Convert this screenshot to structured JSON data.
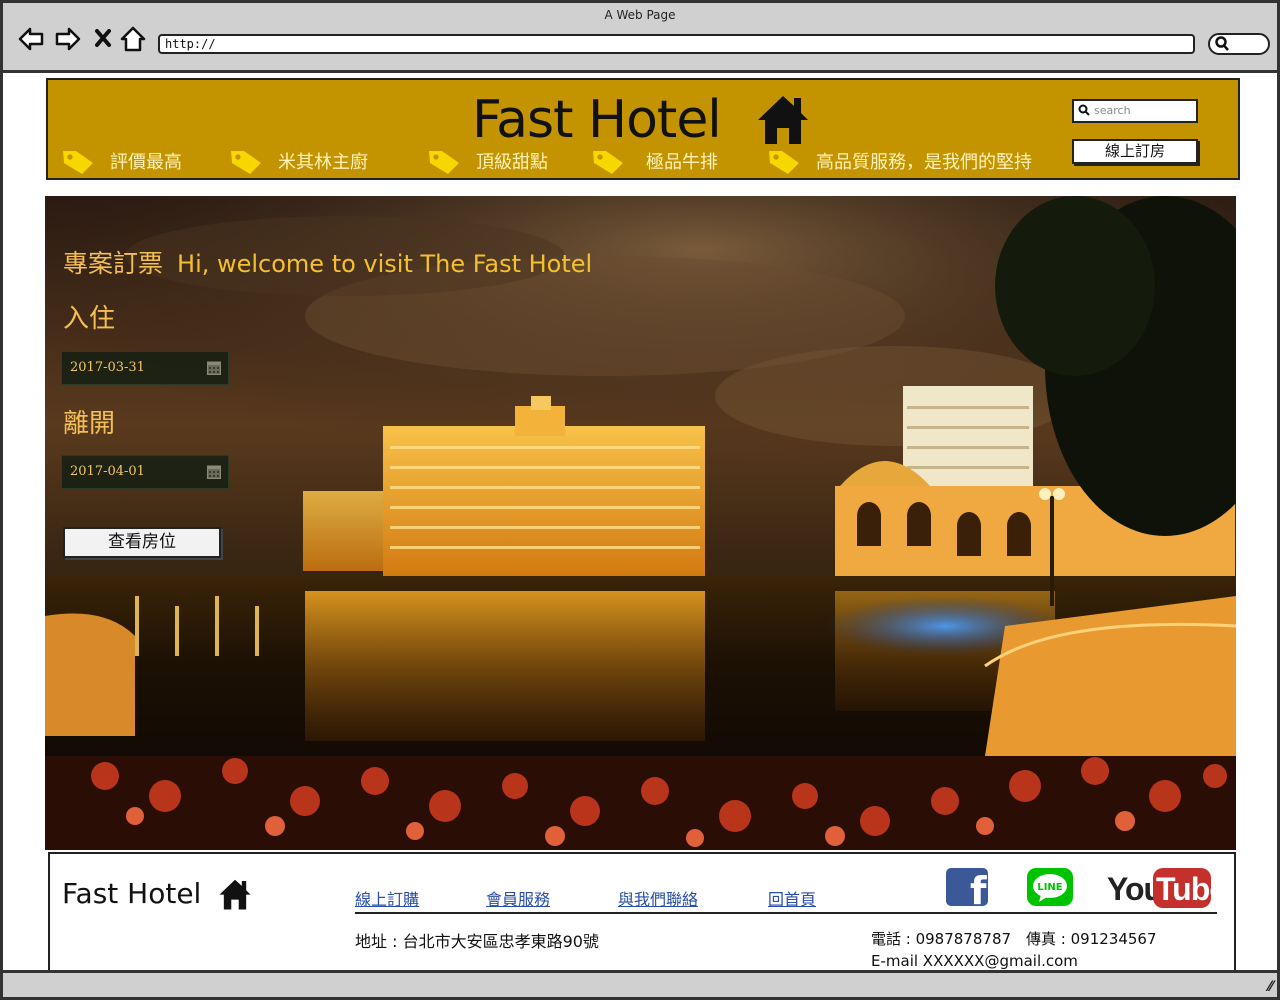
{
  "browser": {
    "window_title": "A Web Page",
    "url": "http://"
  },
  "header": {
    "brand": "Fast Hotel",
    "search_placeholder": "search",
    "booking_button": "線上訂房",
    "nav": [
      {
        "label": "評價最高"
      },
      {
        "label": "米其林主廚"
      },
      {
        "label": "頂級甜點"
      },
      {
        "label": "極品牛排"
      },
      {
        "label": "高品質服務，是我們的堅持"
      }
    ]
  },
  "hero": {
    "heading_zh": "專案訂票",
    "heading_en": "Hi, welcome to visit The Fast Hotel",
    "checkin_label": "入住",
    "checkin_date": "2017-03-31",
    "checkout_label": "離開",
    "checkout_date": "2017-04-01",
    "check_button": "查看房位"
  },
  "footer": {
    "brand": "Fast Hotel",
    "links": [
      {
        "label": "線上訂購"
      },
      {
        "label": "會員服務"
      },
      {
        "label": "與我們聯絡"
      },
      {
        "label": "回首頁"
      }
    ],
    "address": "地址 : 台北市大安區忠孝東路90號",
    "phone_fax": "電話 : 0987878787　傳真 : 091234567",
    "email": "E-mail XXXXXX@gmail.com",
    "social": [
      {
        "icon": "facebook-icon",
        "color": "#3b5998",
        "text": "f"
      },
      {
        "icon": "line-icon",
        "color": "#00c300",
        "text": "LINE"
      },
      {
        "icon": "youtube-icon",
        "color": "#c4302b",
        "text_you": "You",
        "text_tube": "Tube"
      }
    ]
  },
  "colors": {
    "header_bg": "#c49300",
    "hero_text": "#f4bf55",
    "link": "#2a4fa8"
  }
}
